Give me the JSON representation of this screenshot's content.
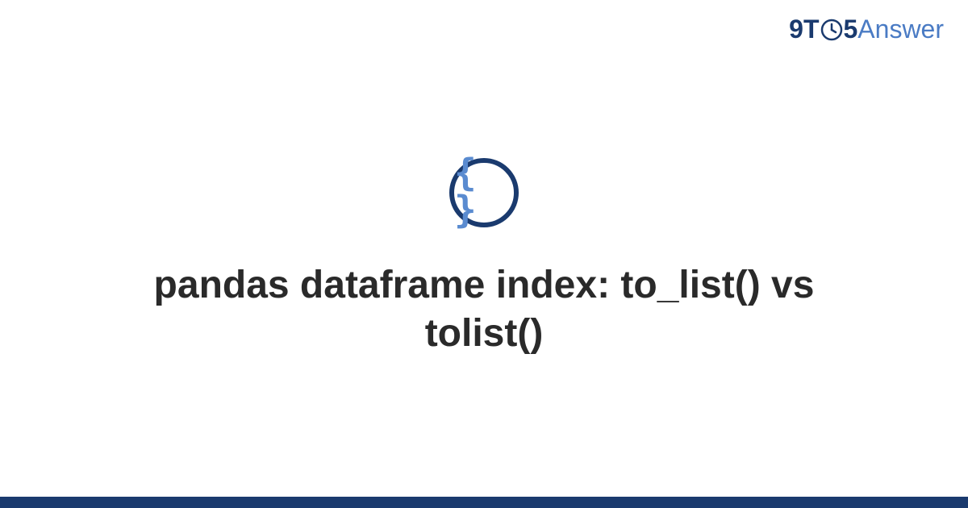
{
  "brand": {
    "part1": "9T",
    "part2": "5",
    "part3": "Answer"
  },
  "hero": {
    "icon_label": "curly-braces",
    "braces_glyph": "{ }",
    "title": "pandas dataframe index: to_list() vs tolist()"
  },
  "colors": {
    "dark_blue": "#1a3a6e",
    "light_blue": "#4a7bc4",
    "icon_blue": "#5a8bd0"
  }
}
